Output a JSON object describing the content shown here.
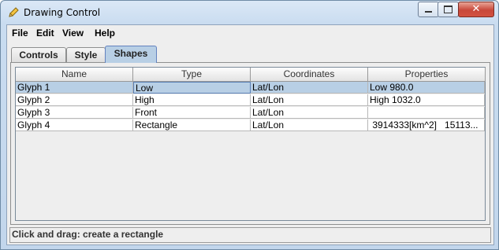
{
  "window": {
    "title": "Drawing Control",
    "close_glyph": "✕"
  },
  "menu": {
    "items": [
      "File",
      "Edit",
      "View",
      "Help"
    ]
  },
  "tabs": [
    {
      "label": "Controls",
      "active": false
    },
    {
      "label": "Style",
      "active": false
    },
    {
      "label": "Shapes",
      "active": true
    }
  ],
  "table": {
    "columns": [
      "Name",
      "Type",
      "Coordinates",
      "Properties"
    ],
    "rows": [
      [
        "Glyph 1",
        "Low",
        "Lat/Lon",
        "Low 980.0"
      ],
      [
        "Glyph 2",
        "High",
        "Lat/Lon",
        "High 1032.0"
      ],
      [
        "Glyph 3",
        "Front",
        "Lat/Lon",
        ""
      ],
      [
        "Glyph 4",
        "Rectangle",
        "Lat/Lon",
        " 3914333[km^2]   15113..."
      ]
    ],
    "selected_row": 0
  },
  "status": {
    "text": "Click and drag: create a rectangle"
  },
  "colors": {
    "selection": "#b8cfe5",
    "close_button": "#c8483a"
  }
}
